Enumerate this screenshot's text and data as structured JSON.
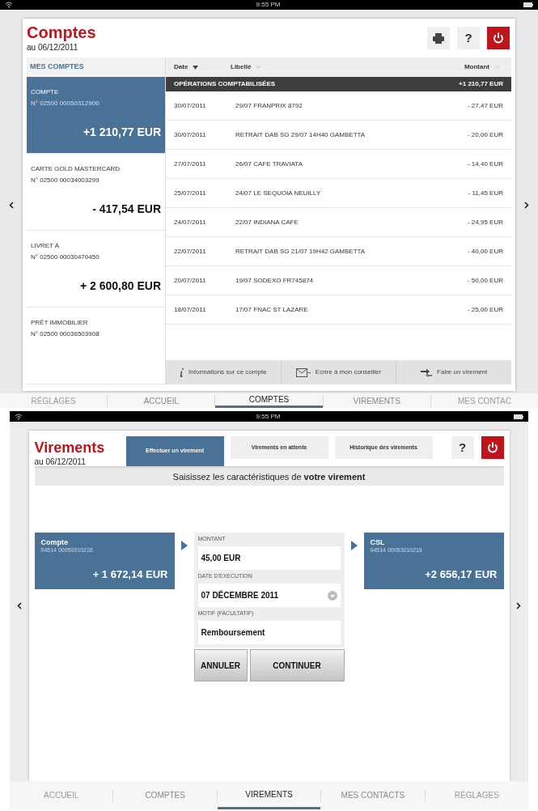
{
  "screens": [
    {
      "kind": "accounts",
      "status_bar": {
        "time": "9:55 PM"
      },
      "title": "Comptes",
      "date": "au 06/12/2011",
      "toolbar": [
        {
          "kind": "print"
        },
        {
          "kind": "help",
          "label": "?"
        },
        {
          "kind": "power"
        }
      ],
      "sidebar": {
        "heading": "MES COMPTES",
        "accounts": [
          {
            "name": "COMPTE",
            "number": "N° 02500 00050312900",
            "balance": "+1 210,77 EUR",
            "selected": true
          },
          {
            "name": "CARTE GOLD MASTERCARD",
            "number": "N° 02500 00034003299",
            "balance": "- 417,54 EUR",
            "selected": false
          },
          {
            "name": "LIVRET A",
            "number": "N° 02500 00030470450",
            "balance": "+ 2 600,80 EUR",
            "selected": false
          },
          {
            "name": "PRÊT IMMOBILIER",
            "number": "N° 02500 00036503908",
            "selected": false
          }
        ]
      },
      "table": {
        "columns": [
          {
            "label": "Date",
            "sorted": true
          },
          {
            "label": "Libellé",
            "sorted": false
          },
          {
            "label": "Montant",
            "sorted": false
          }
        ],
        "section": {
          "label": "OPÉRATIONS COMPTABILISÉES",
          "total": "+1 210,77 EUR"
        },
        "rows": [
          {
            "date": "30/07/2011",
            "label": "29/07 FRANPRIX 8792",
            "amount": "- 27,47 EUR"
          },
          {
            "date": "30/07/2011",
            "label": "RETRAIT DAB SG 29/07 14H40 GAMBETTA",
            "amount": "- 20,00 EUR"
          },
          {
            "date": "27/07/2011",
            "label": "26/07 CAFE TRAVIATA",
            "amount": "- 14,40 EUR"
          },
          {
            "date": "25/07/2011",
            "label": "24/07 LE SEQUOIA NEUILLY",
            "amount": "- 11,45 EUR"
          },
          {
            "date": "24/07/2011",
            "label": "22/07 INDIANA CAFE",
            "amount": "- 24,95 EUR"
          },
          {
            "date": "22/07/2011",
            "label": "RETRAIT DAB SG 21/07 19H42 GAMBETTA",
            "amount": "- 40,00 EUR"
          },
          {
            "date": "20/07/2011",
            "label": "19/07 SODEXO FR745874",
            "amount": "- 50,00 EUR"
          },
          {
            "date": "18/07/2011",
            "label": "17/07 FNAC ST LAZARE",
            "amount": "- 25,00 EUR"
          }
        ],
        "actions": [
          {
            "kind": "info",
            "label": "Informations sur ce compte"
          },
          {
            "kind": "mail",
            "label": "Ecrire à mon conseiller"
          },
          {
            "kind": "transfer",
            "label": "Faire un virement"
          }
        ]
      },
      "nav_tabs": [
        {
          "label": "RÉGLAGES",
          "selected": false
        },
        {
          "label": "ACCUEIL",
          "selected": false
        },
        {
          "label": "COMPTES",
          "selected": true
        },
        {
          "label": "VIREMENTS",
          "selected": false
        },
        {
          "label": "MES CONTAC",
          "selected": false
        }
      ]
    },
    {
      "kind": "transfer",
      "status_bar": {
        "time": "9:55 PM"
      },
      "title": "Virements",
      "date": "au 06/12/2011",
      "segments": [
        {
          "label": "Effectuer un virement",
          "selected": true
        },
        {
          "label": "Virements en attente",
          "selected": false
        },
        {
          "label": "Historique des virements",
          "selected": false
        }
      ],
      "toolbar": [
        {
          "kind": "help",
          "label": "?"
        },
        {
          "kind": "power"
        }
      ],
      "banner": "Saisissez les caractéristiques de **votre virement**",
      "from": {
        "name": "Compte",
        "number": "04514 00050010216",
        "balance": "+ 1 672,14 EUR"
      },
      "form": [
        {
          "kind": "text",
          "label": "MONTANT",
          "value": "45,00 EUR"
        },
        {
          "kind": "date",
          "label": "DATE D'EXECUTION",
          "value": "07 DÉCEMBRE 2011"
        },
        {
          "kind": "text",
          "label": "MOTIF (FACULTATIF)",
          "value": "Remboursement"
        }
      ],
      "buttons": [
        "ANNULER",
        "CONTINUER"
      ],
      "to": {
        "name": "CSL",
        "number": "04514 00053010216",
        "balance": "+2 656,17 EUR"
      },
      "nav_tabs": [
        {
          "label": "ACCUEIL",
          "selected": false
        },
        {
          "label": "COMPTES",
          "selected": false
        },
        {
          "label": "VIREMENTS",
          "selected": true
        },
        {
          "label": "MES CONTACTS",
          "selected": false
        },
        {
          "label": "RÉGLAGES",
          "selected": false
        }
      ]
    }
  ]
}
